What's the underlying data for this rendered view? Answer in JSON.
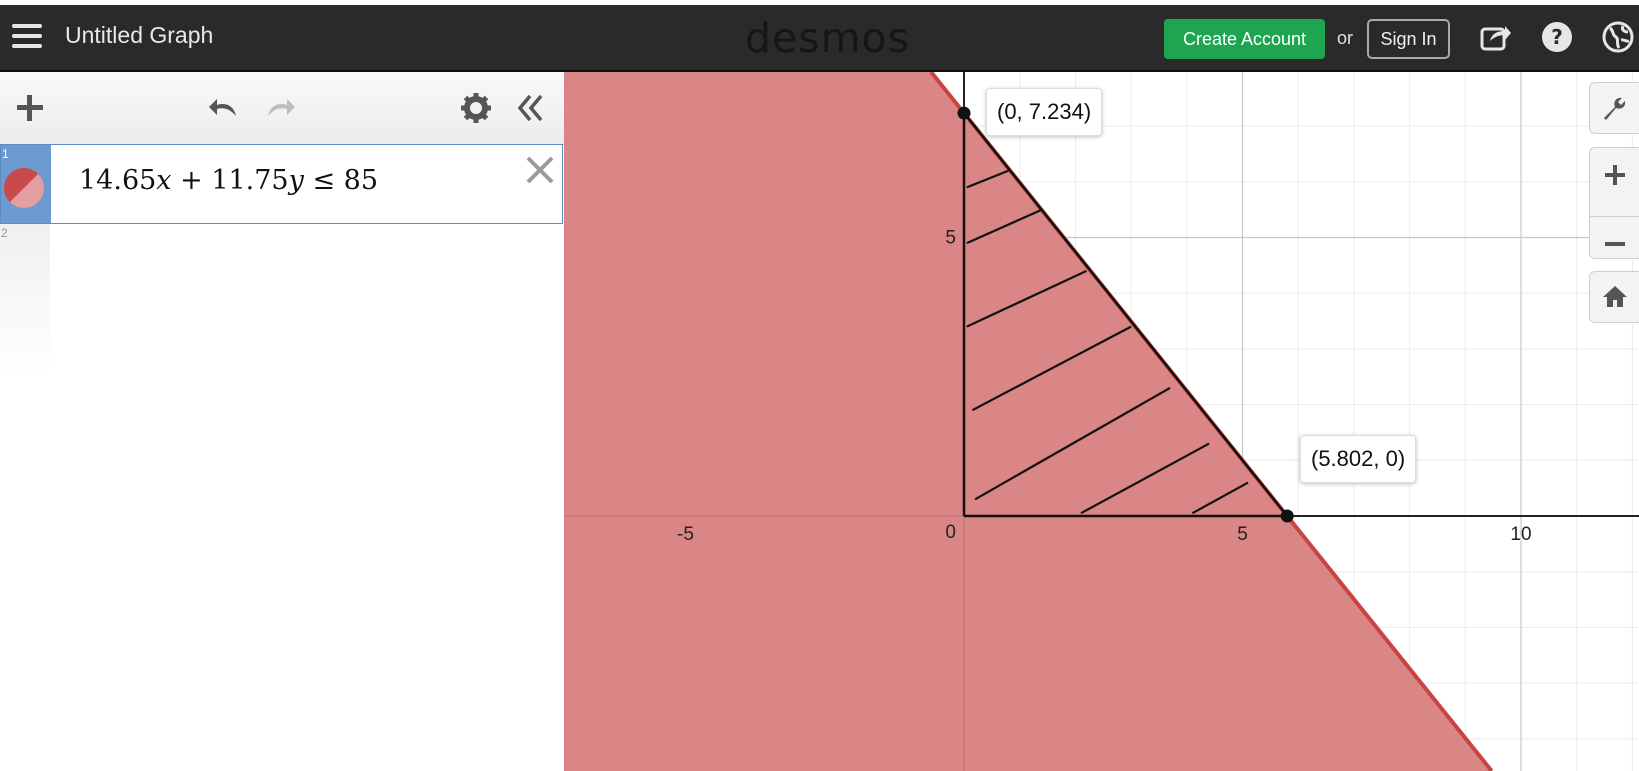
{
  "header": {
    "title": "Untitled Graph",
    "logo": "desmos",
    "create_account_label": "Create Account",
    "or_label": "or",
    "sign_in_label": "Sign In",
    "icons": [
      "menu-icon",
      "share-icon",
      "help-icon",
      "language-icon"
    ]
  },
  "expressions": {
    "items": [
      {
        "index": "1",
        "latex_parts": [
          "14.65",
          "x",
          " + 11.75",
          "y",
          " ≤ 85"
        ],
        "color": "#c74440"
      },
      {
        "index": "2"
      }
    ]
  },
  "graph": {
    "x_ticks": [
      "-5",
      "5",
      "10"
    ],
    "y_ticks": [
      "5"
    ],
    "origin_label": "0",
    "points": [
      {
        "label": "(0, 7.234)",
        "x": 0,
        "y": 7.234
      },
      {
        "label": "(5.802, 0)",
        "x": 5.802,
        "y": 0
      }
    ],
    "inequality": {
      "a": 14.65,
      "b": 11.75,
      "c": 85,
      "fill_color": "#d98080",
      "line_color": "#c74440"
    }
  },
  "side_tools": {
    "icons": [
      "wrench-icon",
      "zoom-in-icon",
      "zoom-out-icon",
      "home-icon"
    ]
  }
}
